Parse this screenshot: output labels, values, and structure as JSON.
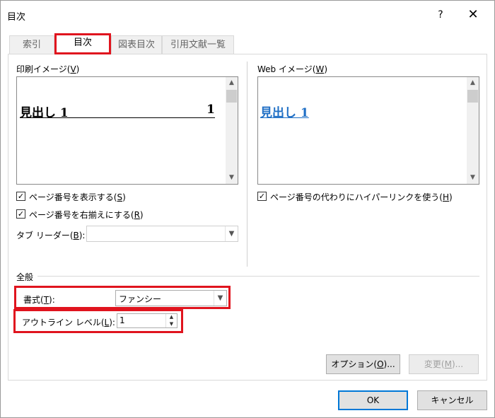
{
  "window": {
    "title": "目次",
    "help_glyph": "?",
    "close_glyph": "✕"
  },
  "tabs": [
    {
      "label": "索引",
      "active": false
    },
    {
      "label": "目次",
      "active": true
    },
    {
      "label": "図表目次",
      "active": false
    },
    {
      "label": "引用文献一覧",
      "active": false
    }
  ],
  "print_preview": {
    "label": "印刷イメージ",
    "label_key_open": "(",
    "label_key": "V",
    "label_key_close": ")",
    "heading": "見出し 1",
    "page_number": "1"
  },
  "web_preview": {
    "label": "Web イメージ",
    "label_key_open": "(",
    "label_key": "W",
    "label_key_close": ")",
    "heading": "見出し 1"
  },
  "options": {
    "show_page_numbers": {
      "label": "ページ番号を表示する",
      "key_open": "(",
      "key": "S",
      "key_close": ")",
      "checked": true
    },
    "right_align_page_numbers": {
      "label": "ページ番号を右揃えにする",
      "key_open": "(",
      "key": "R",
      "key_close": ")",
      "checked": true
    },
    "tab_leader": {
      "label": "タブ リーダー",
      "key_open": "(",
      "key": "B",
      "key_close": "):",
      "value": ""
    },
    "use_hyperlinks": {
      "label": "ページ番号の代わりにハイパーリンクを使う",
      "key_open": "(",
      "key": "H",
      "key_close": ")",
      "checked": true
    }
  },
  "general": {
    "section_label": "全般",
    "format": {
      "label": "書式",
      "key_open": "(",
      "key": "T",
      "key_close": "):",
      "value": "ファンシー"
    },
    "outline_level": {
      "label": "アウトライン レベル",
      "key_open": "(",
      "key": "L",
      "key_close": "):",
      "value": "1"
    }
  },
  "buttons": {
    "options": {
      "label": "オプション",
      "key_open": "(",
      "key": "O",
      "key_close": ")..."
    },
    "modify": {
      "label": "変更",
      "key_open": "(",
      "key": "M",
      "key_close": ")..."
    },
    "ok": "OK",
    "cancel": "キャンセル"
  },
  "glyphs": {
    "check": "✓",
    "scroll_up": "▲",
    "scroll_down": "▼",
    "combo_arrow": "▼",
    "spin_up": "▲",
    "spin_down": "▼"
  },
  "colors": {
    "highlight_red": "#e0141e",
    "hyperlink_blue": "#1f6fc5",
    "default_button_border": "#0078d7"
  }
}
